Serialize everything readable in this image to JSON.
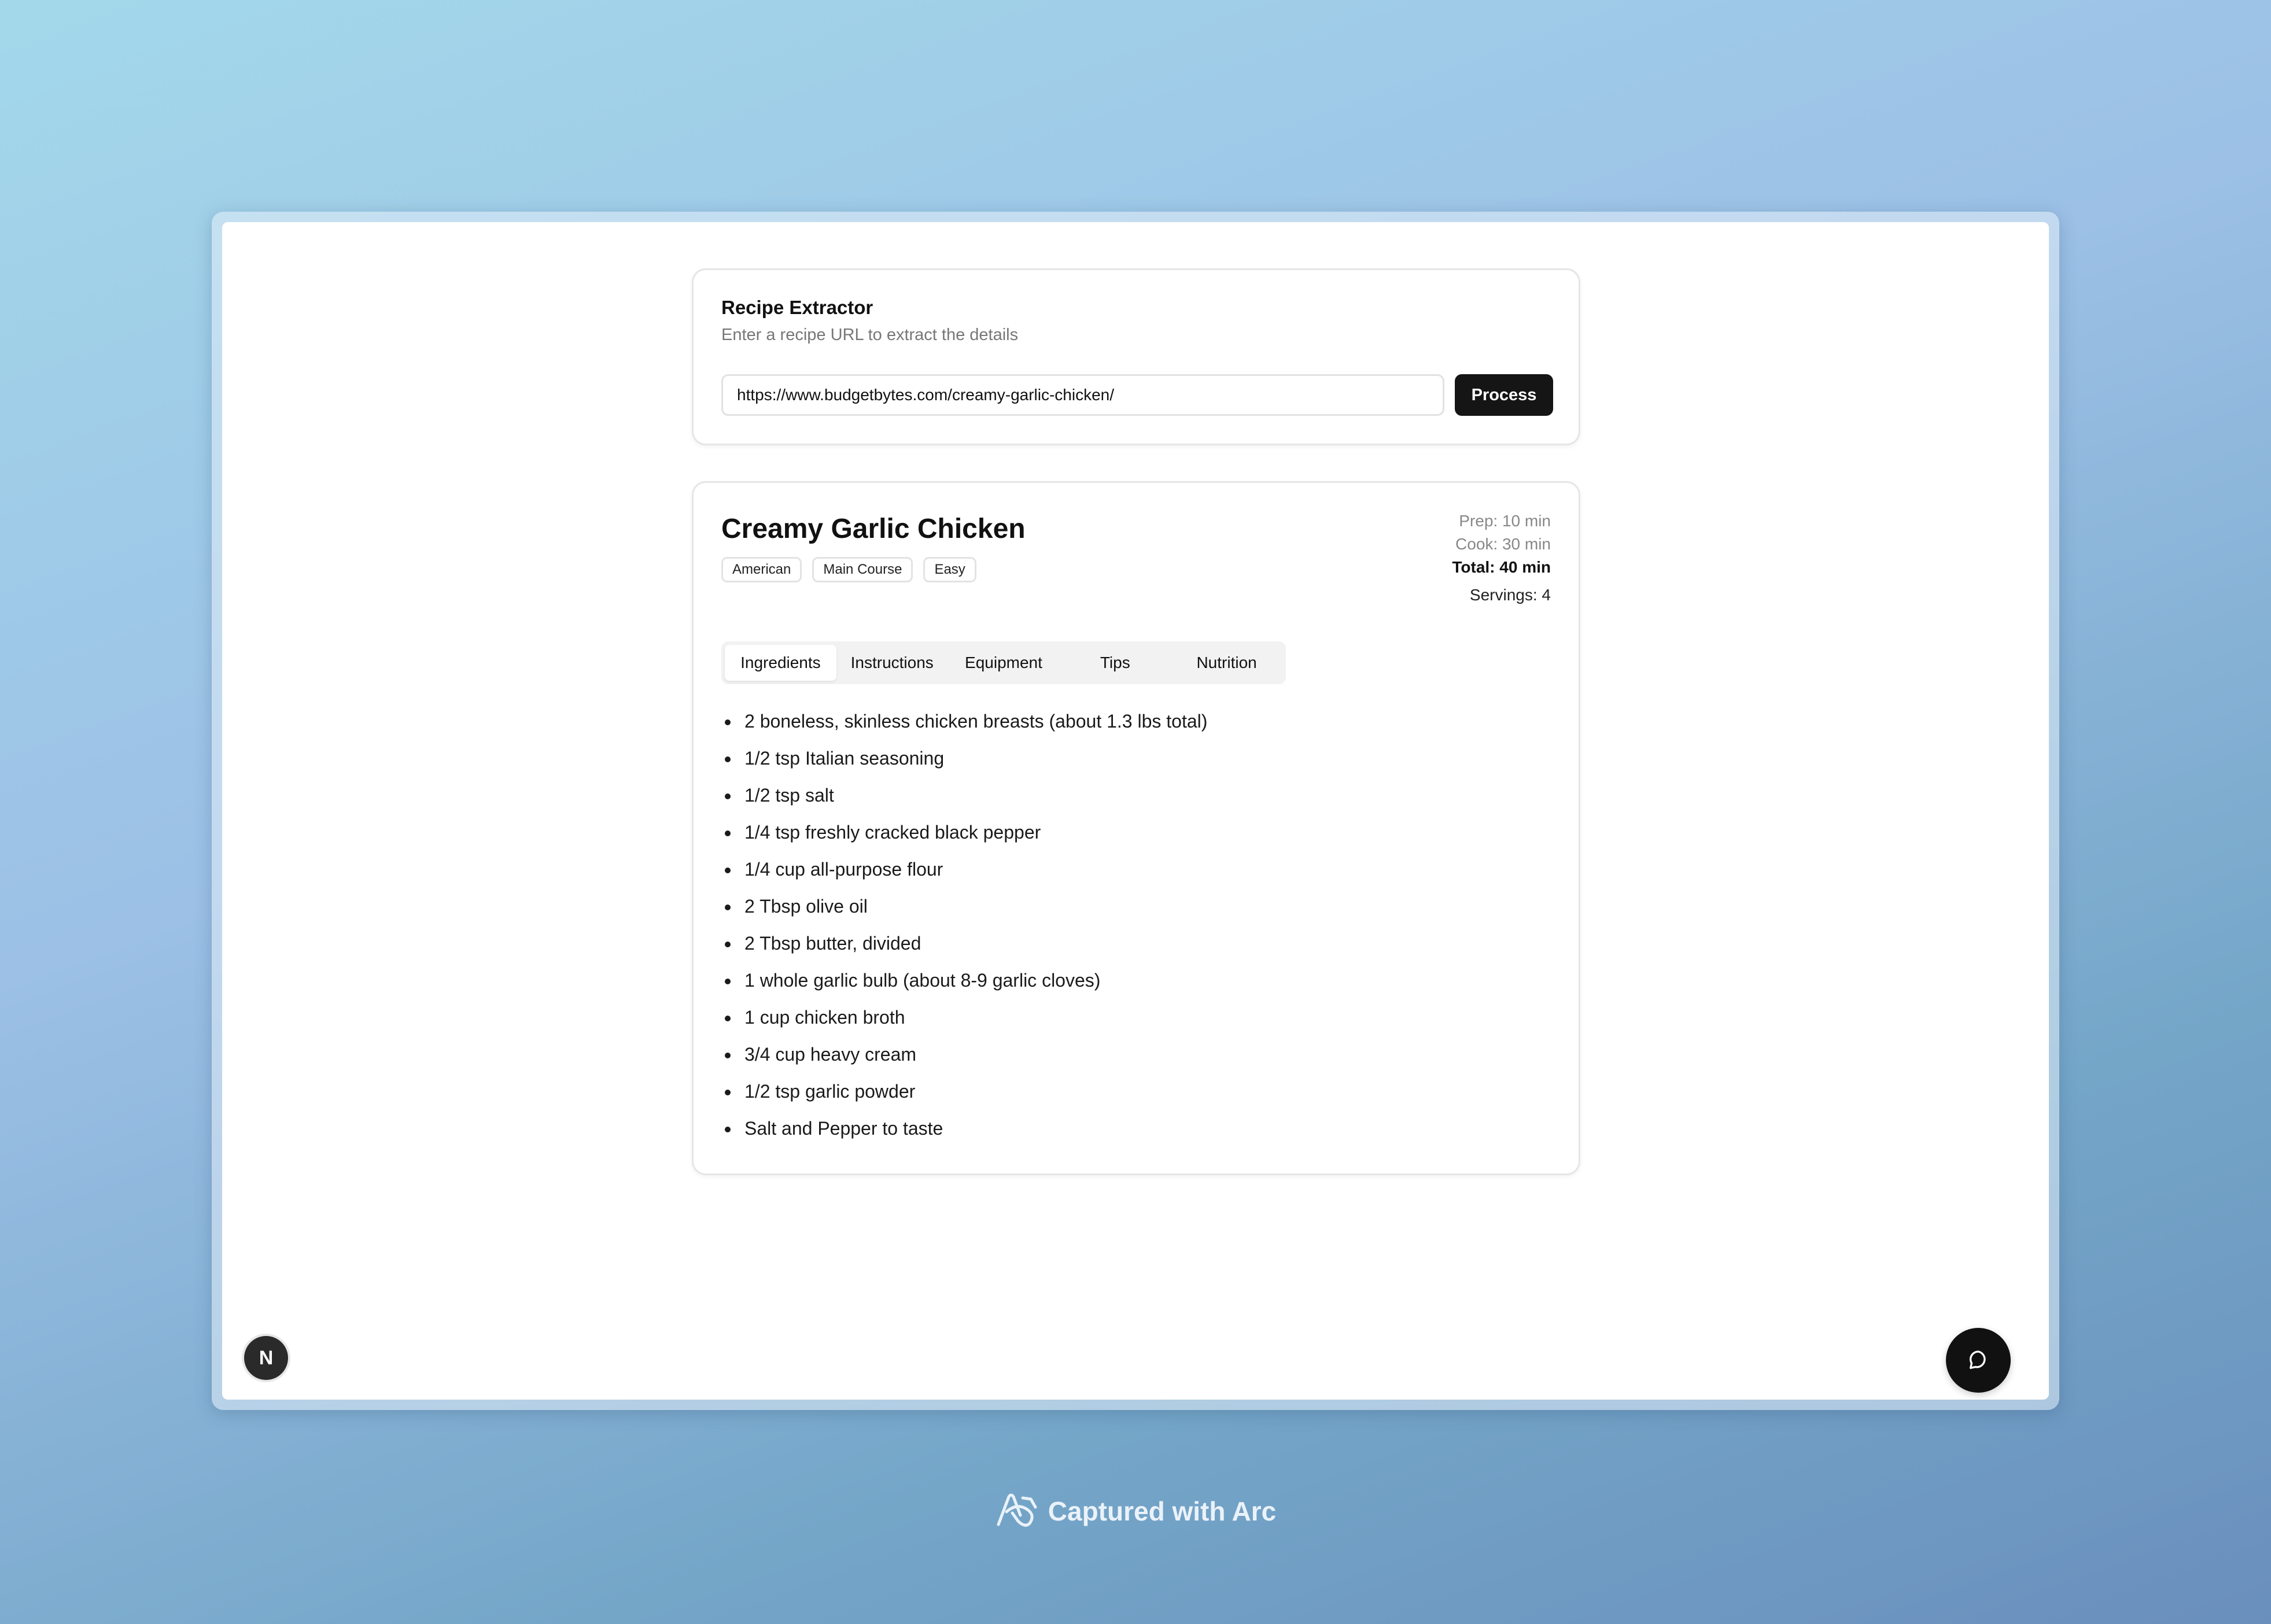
{
  "extractor": {
    "title": "Recipe Extractor",
    "subtitle": "Enter a recipe URL to extract the details",
    "url_value": "https://www.budgetbytes.com/creamy-garlic-chicken/",
    "process_label": "Process"
  },
  "recipe": {
    "title": "Creamy Garlic Chicken",
    "tags": [
      "American",
      "Main Course",
      "Easy"
    ],
    "prep": "Prep: 10 min",
    "cook": "Cook: 30 min",
    "total": "Total: 40 min",
    "servings": "Servings: 4"
  },
  "tabs": [
    {
      "label": "Ingredients",
      "active": true
    },
    {
      "label": "Instructions",
      "active": false
    },
    {
      "label": "Equipment",
      "active": false
    },
    {
      "label": "Tips",
      "active": false
    },
    {
      "label": "Nutrition",
      "active": false
    }
  ],
  "ingredients": [
    "2 boneless, skinless chicken breasts (about 1.3 lbs total)",
    "1/2 tsp Italian seasoning",
    "1/2 tsp salt",
    "1/4 tsp freshly cracked black pepper",
    "1/4 cup all-purpose flour",
    "2 Tbsp olive oil",
    "2 Tbsp butter, divided",
    "1 whole garlic bulb (about 8-9 garlic cloves)",
    "1 cup chicken broth",
    "3/4 cup heavy cream",
    "1/2 tsp garlic powder",
    "Salt and Pepper to taste"
  ],
  "dev_badge": {
    "letter": "N",
    "icon": "nextjs-icon"
  },
  "chat": {
    "icon": "chat-bubble-icon"
  },
  "footer": {
    "text": "Captured with Arc",
    "icon": "arc-logo-icon"
  }
}
